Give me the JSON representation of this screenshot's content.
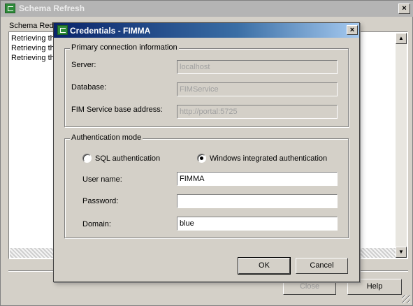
{
  "outer": {
    "title": "Schema Refresh",
    "group_label": "Schema Redi",
    "log_lines": [
      "Retrieving the",
      "Retrieving the",
      "Retrieving the"
    ],
    "close_label": "Close",
    "help_label": "Help",
    "close_glyph": "×"
  },
  "dialog": {
    "title": "Credentials - FIMMA",
    "close_glyph": "×",
    "primary": {
      "title": "Primary connection information",
      "server_label": "Server:",
      "server_value": "localhost",
      "database_label": "Database:",
      "database_value": "FIMService",
      "fim_label": "FIM Service base address:",
      "fim_value": "http://portal:5725"
    },
    "auth": {
      "title": "Authentication mode",
      "sql_label": "SQL authentication",
      "windows_label": "Windows integrated authentication",
      "selected": "windows",
      "username_label": "User name:",
      "username_value": "FIMMA",
      "password_label": "Password:",
      "password_value": "",
      "domain_label": "Domain:",
      "domain_value": "blue"
    },
    "ok_label": "OK",
    "cancel_label": "Cancel"
  },
  "scroll": {
    "up_glyph": "▲",
    "down_glyph": "▼"
  },
  "colors": {
    "dialog_title_start": "#0a246a",
    "dialog_title_end": "#a6caf0",
    "app_icon": "#2e8b3a"
  }
}
